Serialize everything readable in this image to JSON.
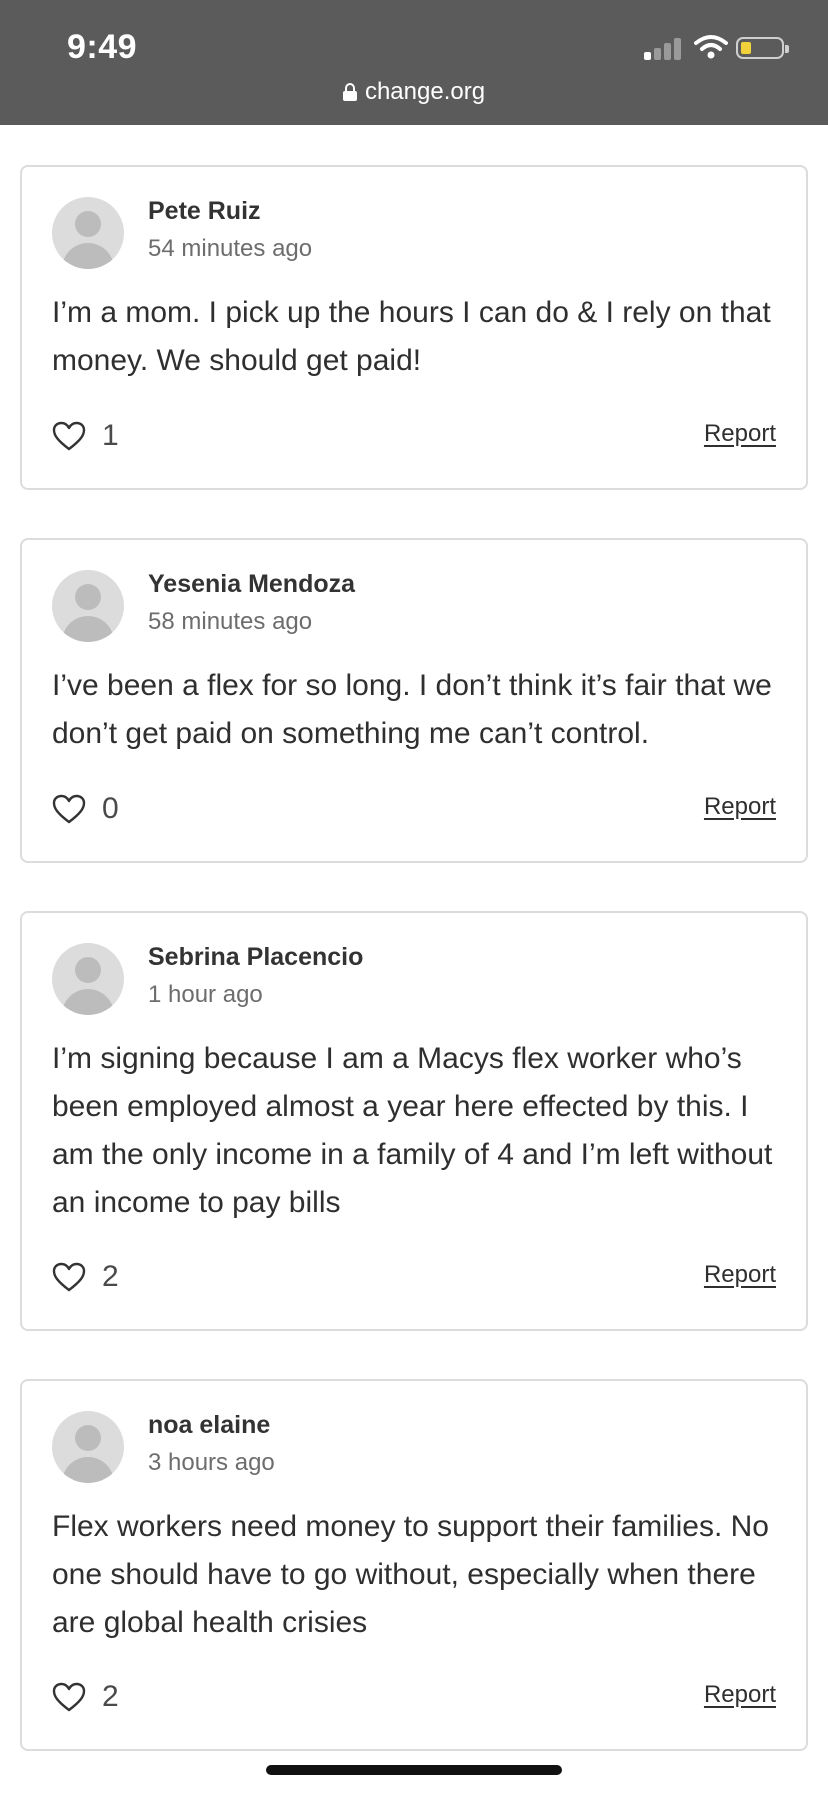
{
  "status_bar": {
    "time": "9:49",
    "signal_icon": "signal-bars-icon",
    "wifi_icon": "wifi-icon",
    "battery_icon": "battery-icon",
    "battery_color": "#f2d23a"
  },
  "browser": {
    "url": "change.org",
    "lock_icon": "lock-icon"
  },
  "comments": [
    {
      "author": "Pete Ruiz",
      "time": "54 minutes ago",
      "text": "I’m a mom. I pick up the hours I can do & I rely on that money. We should get paid!",
      "likes": "1",
      "report_label": "Report"
    },
    {
      "author": "Yesenia Mendoza",
      "time": "58 minutes ago",
      "text": "I’ve been a flex for so long. I don’t think it’s fair that we don’t get paid on something me can’t control.",
      "likes": "0",
      "report_label": "Report"
    },
    {
      "author": "Sebrina Placencio",
      "time": "1 hour ago",
      "text": "I’m signing because I am a Macys flex worker who’s been employed almost a year here effected by this. I am the only income in a family of 4 and I’m left without an income to pay bills",
      "likes": "2",
      "report_label": "Report"
    },
    {
      "author": "noa elaine",
      "time": "3 hours ago",
      "text": "Flex workers need money to support their families. No one should have to go without, especially when there are global health crisies",
      "likes": "2",
      "report_label": "Report"
    }
  ]
}
